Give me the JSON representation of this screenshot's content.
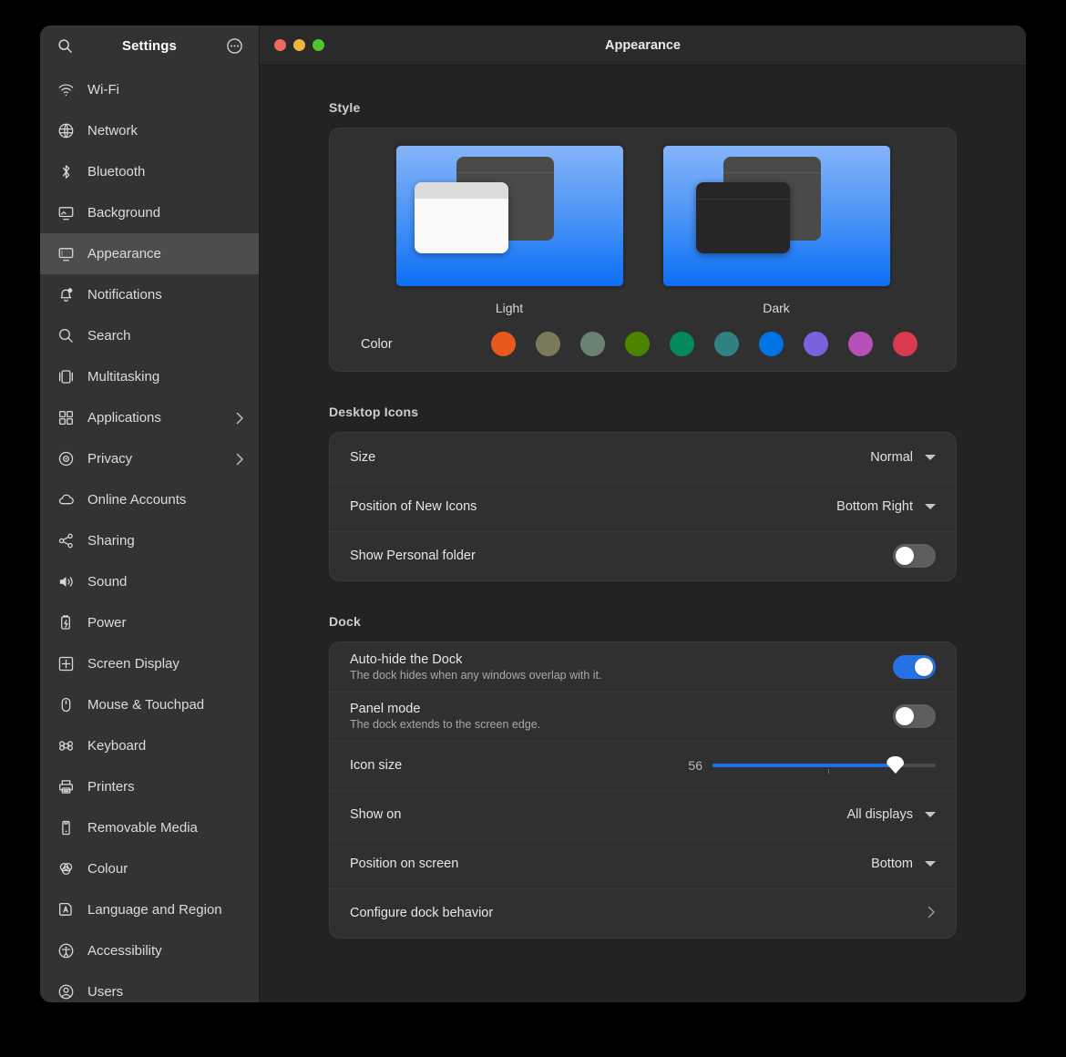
{
  "window": {
    "title": "Appearance",
    "traffic_lights": [
      {
        "name": "close",
        "color": "#ec6a5e"
      },
      {
        "name": "minimize",
        "color": "#efb341"
      },
      {
        "name": "maximize",
        "color": "#4fc62c"
      }
    ]
  },
  "sidebar": {
    "title": "Settings",
    "search_icon": "search-icon",
    "menu_icon": "more-options-icon",
    "items": [
      {
        "label": "Wi-Fi",
        "icon": "wifi-icon",
        "chevron": false,
        "selected": false
      },
      {
        "label": "Network",
        "icon": "network-globe-icon",
        "chevron": false,
        "selected": false
      },
      {
        "label": "Bluetooth",
        "icon": "bluetooth-icon",
        "chevron": false,
        "selected": false
      },
      {
        "label": "Background",
        "icon": "background-icon",
        "chevron": false,
        "selected": false
      },
      {
        "label": "Appearance",
        "icon": "appearance-icon",
        "chevron": false,
        "selected": true
      },
      {
        "label": "Notifications",
        "icon": "notifications-icon",
        "chevron": false,
        "selected": false
      },
      {
        "label": "Search",
        "icon": "search-icon",
        "chevron": false,
        "selected": false
      },
      {
        "label": "Multitasking",
        "icon": "multitasking-icon",
        "chevron": false,
        "selected": false
      },
      {
        "label": "Applications",
        "icon": "applications-grid-icon",
        "chevron": true,
        "selected": false
      },
      {
        "label": "Privacy",
        "icon": "privacy-icon",
        "chevron": true,
        "selected": false
      },
      {
        "label": "Online Accounts",
        "icon": "cloud-icon",
        "chevron": false,
        "selected": false
      },
      {
        "label": "Sharing",
        "icon": "sharing-icon",
        "chevron": false,
        "selected": false
      },
      {
        "label": "Sound",
        "icon": "sound-speaker-icon",
        "chevron": false,
        "selected": false
      },
      {
        "label": "Power",
        "icon": "power-battery-icon",
        "chevron": false,
        "selected": false
      },
      {
        "label": "Screen Display",
        "icon": "screen-display-icon",
        "chevron": false,
        "selected": false
      },
      {
        "label": "Mouse & Touchpad",
        "icon": "mouse-icon",
        "chevron": false,
        "selected": false
      },
      {
        "label": "Keyboard",
        "icon": "keyboard-command-icon",
        "chevron": false,
        "selected": false
      },
      {
        "label": "Printers",
        "icon": "printer-icon",
        "chevron": false,
        "selected": false
      },
      {
        "label": "Removable Media",
        "icon": "removable-media-icon",
        "chevron": false,
        "selected": false
      },
      {
        "label": "Colour",
        "icon": "colour-icon",
        "chevron": false,
        "selected": false
      },
      {
        "label": "Language and Region",
        "icon": "language-region-icon",
        "chevron": false,
        "selected": false
      },
      {
        "label": "Accessibility",
        "icon": "accessibility-icon",
        "chevron": false,
        "selected": false
      },
      {
        "label": "Users",
        "icon": "users-avatar-icon",
        "chevron": false,
        "selected": false
      }
    ]
  },
  "style_section": {
    "heading": "Style",
    "options": [
      {
        "label": "Light",
        "selected": false
      },
      {
        "label": "Dark",
        "selected": false
      }
    ],
    "color_label": "Color",
    "colors": [
      {
        "name": "orange",
        "hex": "#e8581f"
      },
      {
        "name": "bark",
        "hex": "#7c7a5d"
      },
      {
        "name": "sage",
        "hex": "#6b8172"
      },
      {
        "name": "olive",
        "hex": "#4c8500"
      },
      {
        "name": "viridian",
        "hex": "#04885e"
      },
      {
        "name": "prussian-green",
        "hex": "#308280"
      },
      {
        "name": "blue",
        "hex": "#0073e5"
      },
      {
        "name": "purple",
        "hex": "#7a62dd"
      },
      {
        "name": "magenta",
        "hex": "#b750b7"
      },
      {
        "name": "red",
        "hex": "#d93a50"
      }
    ]
  },
  "desktop_icons_section": {
    "heading": "Desktop Icons",
    "rows": [
      {
        "title": "Size",
        "control": "combo",
        "value": "Normal"
      },
      {
        "title": "Position of New Icons",
        "control": "combo",
        "value": "Bottom Right"
      },
      {
        "title": "Show Personal folder",
        "control": "toggle",
        "value": "off"
      }
    ]
  },
  "dock_section": {
    "heading": "Dock",
    "rows": [
      {
        "title": "Auto-hide the Dock",
        "subtitle": "The dock hides when any windows overlap with it.",
        "control": "toggle",
        "value": "on"
      },
      {
        "title": "Panel mode",
        "subtitle": "The dock extends to the screen edge.",
        "control": "toggle",
        "value": "off"
      },
      {
        "title": "Icon size",
        "control": "slider",
        "value": "56",
        "fill_percent": "82"
      },
      {
        "title": "Show on",
        "control": "combo",
        "value": "All displays"
      },
      {
        "title": "Position on screen",
        "control": "combo",
        "value": "Bottom"
      },
      {
        "title": "Configure dock behavior",
        "control": "chevron",
        "value": ""
      }
    ]
  }
}
